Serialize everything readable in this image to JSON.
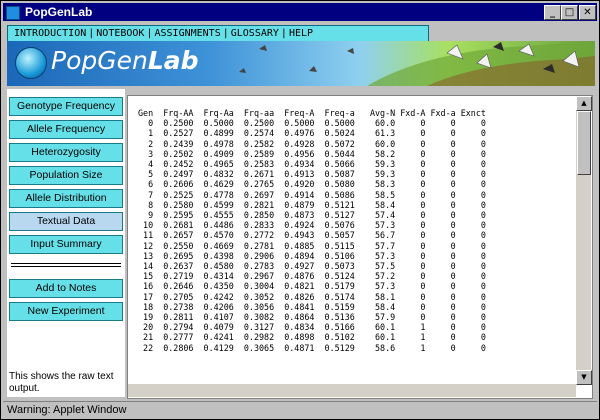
{
  "window": {
    "title": "PopGenLab"
  },
  "menu": {
    "items": [
      "INTRODUCTION",
      "NOTEBOOK",
      "ASSIGNMENTS",
      "GLOSSARY",
      "HELP"
    ]
  },
  "banner": {
    "logo_prefix": "PopGen",
    "logo_bold": "Lab"
  },
  "nav": {
    "items": [
      {
        "label": "Genotype Frequency"
      },
      {
        "label": "Allele Frequency"
      },
      {
        "label": "Heterozygosity"
      },
      {
        "label": "Population Size"
      },
      {
        "label": "Allele Distribution"
      },
      {
        "label": "Textual Data",
        "active": true
      },
      {
        "label": "Input Summary"
      }
    ],
    "notes_label": "Add to Notes",
    "new_exp_label": "New Experiment",
    "help_text": "This shows the raw text output."
  },
  "output": {
    "headers": [
      "Gen",
      "Frq-AA",
      "Frq-Aa",
      "Frq-aa",
      "Freq-A",
      "Freq-a",
      "Avg-N",
      "Fxd-A",
      "Fxd-a",
      "Exnct"
    ],
    "rows": [
      [
        "0",
        "0.2500",
        "0.5000",
        "0.2500",
        "0.5000",
        "0.5000",
        "60.0",
        "0",
        "0",
        "0"
      ],
      [
        "1",
        "0.2527",
        "0.4899",
        "0.2574",
        "0.4976",
        "0.5024",
        "61.3",
        "0",
        "0",
        "0"
      ],
      [
        "2",
        "0.2439",
        "0.4978",
        "0.2582",
        "0.4928",
        "0.5072",
        "60.0",
        "0",
        "0",
        "0"
      ],
      [
        "3",
        "0.2502",
        "0.4909",
        "0.2589",
        "0.4956",
        "0.5044",
        "58.2",
        "0",
        "0",
        "0"
      ],
      [
        "4",
        "0.2452",
        "0.4965",
        "0.2583",
        "0.4934",
        "0.5066",
        "59.3",
        "0",
        "0",
        "0"
      ],
      [
        "5",
        "0.2497",
        "0.4832",
        "0.2671",
        "0.4913",
        "0.5087",
        "59.3",
        "0",
        "0",
        "0"
      ],
      [
        "6",
        "0.2606",
        "0.4629",
        "0.2765",
        "0.4920",
        "0.5080",
        "58.3",
        "0",
        "0",
        "0"
      ],
      [
        "7",
        "0.2525",
        "0.4778",
        "0.2697",
        "0.4914",
        "0.5086",
        "58.5",
        "0",
        "0",
        "0"
      ],
      [
        "8",
        "0.2580",
        "0.4599",
        "0.2821",
        "0.4879",
        "0.5121",
        "58.4",
        "0",
        "0",
        "0"
      ],
      [
        "9",
        "0.2595",
        "0.4555",
        "0.2850",
        "0.4873",
        "0.5127",
        "57.4",
        "0",
        "0",
        "0"
      ],
      [
        "10",
        "0.2681",
        "0.4486",
        "0.2833",
        "0.4924",
        "0.5076",
        "57.3",
        "0",
        "0",
        "0"
      ],
      [
        "11",
        "0.2657",
        "0.4570",
        "0.2772",
        "0.4943",
        "0.5057",
        "56.7",
        "0",
        "0",
        "0"
      ],
      [
        "12",
        "0.2550",
        "0.4669",
        "0.2781",
        "0.4885",
        "0.5115",
        "57.7",
        "0",
        "0",
        "0"
      ],
      [
        "13",
        "0.2695",
        "0.4398",
        "0.2906",
        "0.4894",
        "0.5106",
        "57.3",
        "0",
        "0",
        "0"
      ],
      [
        "14",
        "0.2637",
        "0.4580",
        "0.2783",
        "0.4927",
        "0.5073",
        "57.5",
        "0",
        "0",
        "0"
      ],
      [
        "15",
        "0.2719",
        "0.4314",
        "0.2967",
        "0.4876",
        "0.5124",
        "57.2",
        "0",
        "0",
        "0"
      ],
      [
        "16",
        "0.2646",
        "0.4350",
        "0.3004",
        "0.4821",
        "0.5179",
        "57.3",
        "0",
        "0",
        "0"
      ],
      [
        "17",
        "0.2705",
        "0.4242",
        "0.3052",
        "0.4826",
        "0.5174",
        "58.1",
        "0",
        "0",
        "0"
      ],
      [
        "18",
        "0.2738",
        "0.4206",
        "0.3056",
        "0.4841",
        "0.5159",
        "58.4",
        "0",
        "0",
        "0"
      ],
      [
        "19",
        "0.2811",
        "0.4107",
        "0.3082",
        "0.4864",
        "0.5136",
        "57.9",
        "0",
        "0",
        "0"
      ],
      [
        "20",
        "0.2794",
        "0.4079",
        "0.3127",
        "0.4834",
        "0.5166",
        "60.1",
        "1",
        "0",
        "0"
      ],
      [
        "21",
        "0.2777",
        "0.4241",
        "0.2982",
        "0.4898",
        "0.5102",
        "60.1",
        "1",
        "0",
        "0"
      ],
      [
        "22",
        "0.2806",
        "0.4129",
        "0.3065",
        "0.4871",
        "0.5129",
        "58.6",
        "1",
        "0",
        "0"
      ]
    ]
  },
  "status": {
    "text": "Warning: Applet Window"
  },
  "colors": {
    "titlebar": "#000080",
    "accent": "#66e0e8",
    "banner_blue": "#1b67b8"
  }
}
